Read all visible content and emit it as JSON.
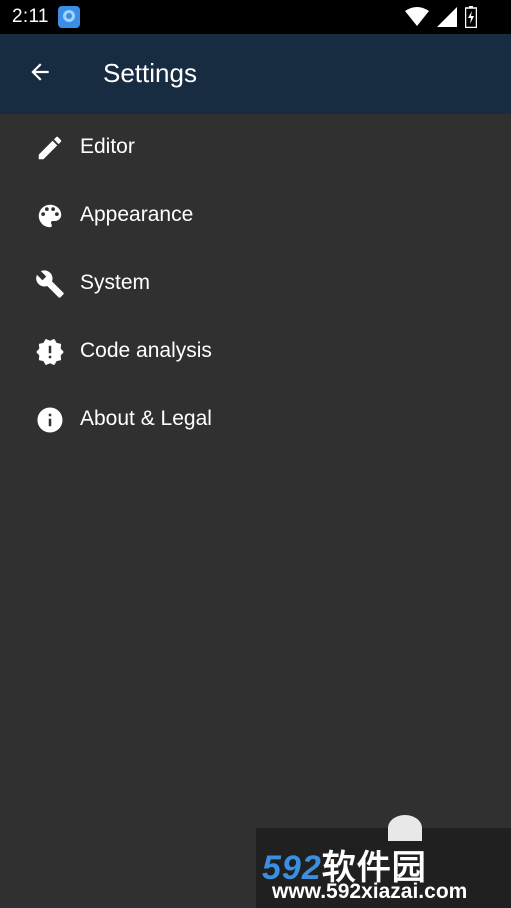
{
  "status_bar": {
    "time": "2:11"
  },
  "app_bar": {
    "title": "Settings"
  },
  "settings": {
    "items": [
      {
        "label": "Editor",
        "icon": "pencil-icon"
      },
      {
        "label": "Appearance",
        "icon": "palette-icon"
      },
      {
        "label": "System",
        "icon": "wrench-icon"
      },
      {
        "label": "Code analysis",
        "icon": "alert-badge-icon"
      },
      {
        "label": "About & Legal",
        "icon": "info-icon"
      }
    ]
  },
  "watermark": {
    "brand_number": "592",
    "brand_cn": "软件园",
    "url": "www.592xiazai.com"
  },
  "colors": {
    "background": "#303030",
    "app_bar": "#172b41",
    "status_bar": "#000000",
    "text": "#ffffff"
  }
}
